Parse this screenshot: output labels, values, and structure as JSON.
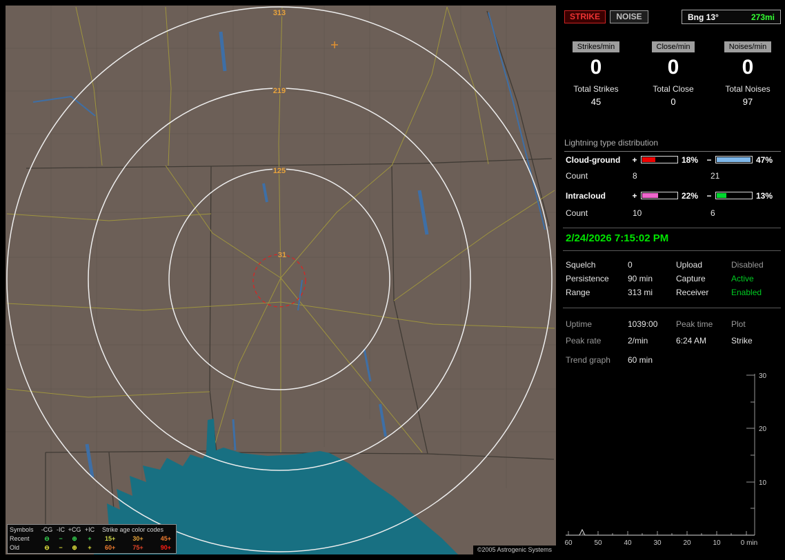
{
  "map": {
    "range_labels": [
      "313",
      "219",
      "125",
      "31"
    ],
    "copyright": "©2005 Astrogenic Systems",
    "legend": {
      "symbols_header": "Symbols",
      "columns": [
        "-CG",
        "-IC",
        "+CG",
        "+IC"
      ],
      "age_header": "Strike age color codes",
      "symbol_glyphs": [
        "⊖",
        "−",
        "⊕",
        "+"
      ],
      "rows": [
        {
          "label": "Recent",
          "ages": [
            "15+",
            "30+",
            "45+"
          ]
        },
        {
          "label": "Old",
          "ages": [
            "60+",
            "75+",
            "90+"
          ]
        }
      ]
    }
  },
  "panel": {
    "strike_button": "STRIKE",
    "noise_button": "NOISE",
    "bearing": "Bng 13°",
    "distance": "273mi",
    "rates": [
      {
        "badge": "Strikes/min",
        "value": "0",
        "total_label": "Total Strikes",
        "total_value": "45"
      },
      {
        "badge": "Close/min",
        "value": "0",
        "total_label": "Total Close",
        "total_value": "0"
      },
      {
        "badge": "Noises/min",
        "value": "0",
        "total_label": "Total Noises",
        "total_value": "97"
      }
    ],
    "distribution": {
      "title": "Lightning type distribution",
      "count_label": "Count",
      "rows": [
        {
          "label": "Cloud-ground",
          "plus_sign": "+",
          "plus_pct": "18%",
          "minus_sign": "−",
          "minus_pct": "47%",
          "plus_count": "8",
          "minus_count": "21"
        },
        {
          "label": "Intracloud",
          "plus_sign": "+",
          "plus_pct": "22%",
          "minus_sign": "−",
          "minus_pct": "13%",
          "plus_count": "10",
          "minus_count": "6"
        }
      ]
    },
    "datetime": "2/24/2026 7:15:02 PM",
    "status_rows": [
      {
        "label": "Squelch",
        "value": "0",
        "label2": "Upload",
        "value2": "Disabled"
      },
      {
        "label": "Persistence",
        "value": "90 min",
        "label2": "Capture",
        "value2": "Active"
      },
      {
        "label": "Range",
        "value": "313 mi",
        "label2": "Receiver",
        "value2": "Enabled"
      }
    ],
    "stats": {
      "uptime_label": "Uptime",
      "uptime_value": "1039:00",
      "peak_time_label": "Peak time",
      "peak_time_value": "6:24 AM",
      "plot_label": "Plot",
      "plot_value": "Strike",
      "peak_rate_label": "Peak rate",
      "peak_rate_value": "2/min",
      "trend_label": "Trend graph",
      "trend_value": "60 min"
    },
    "chart": {
      "y_ticks": [
        "30",
        "20",
        "10"
      ],
      "x_ticks": [
        "60",
        "50",
        "40",
        "30",
        "20",
        "10",
        "0 min"
      ]
    }
  },
  "colors": {
    "map_land": "#6c5f57",
    "gulf_water": "#187082",
    "road_yellow": "#9e943e",
    "river_blue": "#3e6fa6",
    "range_ring_white": "#eeeeee",
    "range_label_orange": "#e8a33c",
    "alert_ring_red": "#dd2222",
    "strike_red": "#ee3333",
    "accent_green": "#00e400",
    "distance_green": "#33ff33",
    "bar_cg_plus": "#f00000",
    "bar_cg_minus": "#7fb8ea",
    "bar_ic_plus": "#ee66cc",
    "bar_ic_minus": "#00d830"
  }
}
